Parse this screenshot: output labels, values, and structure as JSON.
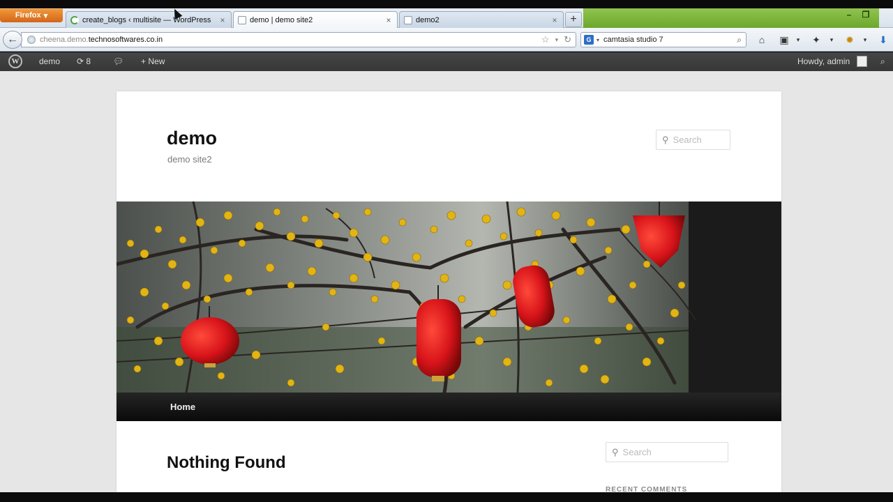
{
  "browser": {
    "menu_button_label": "Firefox",
    "tabs": [
      {
        "title": "create_blogs ‹ multisite — WordPress"
      },
      {
        "title": "demo | demo site2"
      },
      {
        "title": "demo2"
      }
    ],
    "new_tab_label": "+",
    "url_host_dim": "cheena.demo.",
    "url_host": "technosoftwares.co.in",
    "search_engine_letter": "G",
    "search_query": "camtasia studio 7"
  },
  "adminbar": {
    "site_name": "demo",
    "updates_count": "8",
    "new_label": "New",
    "greeting": "Howdy, admin"
  },
  "site": {
    "title": "demo",
    "description": "demo site2",
    "header_search_placeholder": "Search",
    "menu": [
      {
        "label": "Home"
      }
    ],
    "content_heading": "Nothing Found",
    "sidebar_search_placeholder": "Search",
    "widget_heading": "RECENT COMMENTS"
  },
  "colors": {
    "firefox_orange": "#e37f2a",
    "adminbar_bg": "#3f3f3f",
    "page_bg": "#e6e6e6",
    "menu_bg": "#151515",
    "lantern_red": "#d8141a",
    "blossom_yellow": "#e2b414"
  }
}
